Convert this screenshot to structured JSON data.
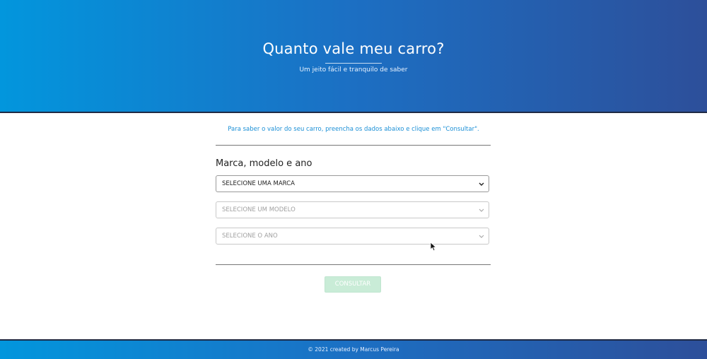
{
  "header": {
    "title": "Quanto vale meu carro?",
    "subtitle": "Um jeito fácil e tranquilo de saber"
  },
  "intro": {
    "text": "Para saber o valor do seu carro, preencha os dados abaixo e clique em \"Consultar\"."
  },
  "form": {
    "section_title": "Marca, modelo e ano",
    "brand_select": {
      "value": "SELECIONE UMA MARCA",
      "enabled": true
    },
    "model_select": {
      "value": "SELECIONE UM MODELO",
      "enabled": false
    },
    "year_select": {
      "value": "SELECIONE O ANO",
      "enabled": false
    },
    "submit_label": "CONSULTAR"
  },
  "footer": {
    "text": "© 2021 created by Marcus Pereira"
  },
  "colors": {
    "accent_blue": "#1a8fd6",
    "gradient_start": "#0296dd",
    "gradient_end": "#2d4f9a",
    "button_disabled": "#c9ecd7"
  },
  "icons": [
    "chevron-down-icon",
    "mouse-cursor-icon"
  ]
}
